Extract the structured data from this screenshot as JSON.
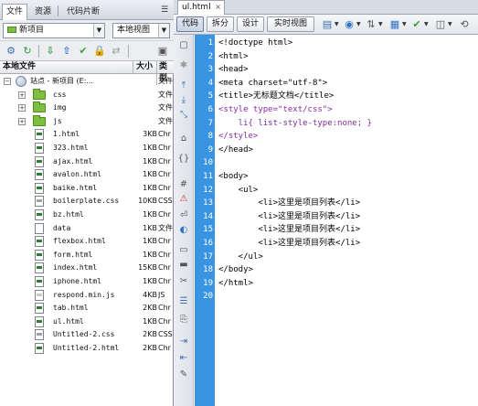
{
  "panel": {
    "tabs": [
      {
        "label": "文件",
        "active": true
      },
      {
        "label": "资源",
        "active": false
      },
      {
        "label": "代码片断",
        "active": false
      }
    ],
    "menu_icon": "panel-menu-icon",
    "site_select": "新项目",
    "view_select": "本地视图",
    "toolbar_icons": [
      "connect-icon",
      "refresh-icon",
      "get-file-icon",
      "put-file-icon",
      "checkout-icon",
      "checkin-icon",
      "sync-icon",
      "expand-icon"
    ],
    "columns": {
      "name": "本地文件",
      "size": "大小",
      "type": "类型"
    },
    "root": {
      "label": "站点 - 新项目 (E:...",
      "type": "文件"
    },
    "folders": [
      {
        "name": "css",
        "type": "文件"
      },
      {
        "name": "img",
        "type": "文件"
      },
      {
        "name": "js",
        "type": "文件"
      }
    ],
    "files": [
      {
        "name": "1.html",
        "size": "3KB",
        "type": "Chr",
        "kind": "html"
      },
      {
        "name": "323.html",
        "size": "1KB",
        "type": "Chr",
        "kind": "html"
      },
      {
        "name": "ajax.html",
        "size": "1KB",
        "type": "Chr",
        "kind": "html"
      },
      {
        "name": "avalon.html",
        "size": "1KB",
        "type": "Chr",
        "kind": "html"
      },
      {
        "name": "baike.html",
        "size": "1KB",
        "type": "Chr",
        "kind": "html"
      },
      {
        "name": "boilerplate.css",
        "size": "10KB",
        "type": "CSS",
        "kind": "css"
      },
      {
        "name": "bz.html",
        "size": "1KB",
        "type": "Chr",
        "kind": "html"
      },
      {
        "name": "data",
        "size": "1KB",
        "type": "文件",
        "kind": "doc"
      },
      {
        "name": "flexbox.html",
        "size": "1KB",
        "type": "Chr",
        "kind": "html"
      },
      {
        "name": "form.html",
        "size": "1KB",
        "type": "Chr",
        "kind": "html"
      },
      {
        "name": "index.html",
        "size": "15KB",
        "type": "Chr",
        "kind": "html"
      },
      {
        "name": "iphone.html",
        "size": "1KB",
        "type": "Chr",
        "kind": "html"
      },
      {
        "name": "respond.min.js",
        "size": "4KB",
        "type": "JS",
        "kind": "js"
      },
      {
        "name": "tab.html",
        "size": "2KB",
        "type": "Chr",
        "kind": "html"
      },
      {
        "name": "ul.html",
        "size": "1KB",
        "type": "Chr",
        "kind": "html"
      },
      {
        "name": "Untitled-2.css",
        "size": "2KB",
        "type": "CSS",
        "kind": "css"
      },
      {
        "name": "Untitled-2.html",
        "size": "2KB",
        "type": "Chr",
        "kind": "html"
      }
    ]
  },
  "editor": {
    "doc_tab": "ul.html",
    "close_glyph": "×",
    "view_buttons": [
      {
        "label": "代码",
        "active": true
      },
      {
        "label": "拆分",
        "active": false
      },
      {
        "label": "设计",
        "active": false
      },
      {
        "label": "实时视图",
        "active": false
      }
    ],
    "view_icons": [
      "multiscreen-icon",
      "browser-preview-icon",
      "file-management-icon",
      "page-title-icon",
      "check-page-icon",
      "visual-aids-icon",
      "refresh-icon"
    ],
    "gutter_icons": [
      "open-documents-icon",
      "show-code-navigator-icon",
      "collapse-full-tag-icon",
      "collapse-selection-icon",
      "expand-all-icon",
      "select-parent-tag-icon",
      "balance-braces-icon",
      "line-numbers-icon",
      "highlight-invalid-icon",
      "word-wrap-icon",
      "syntax-coloring-icon",
      "apply-comment-icon",
      "remove-comment-icon",
      "wrap-tag-icon",
      "recent-snippets-icon",
      "move-css-icon",
      "indent-icon",
      "outdent-icon",
      "format-source-icon"
    ],
    "lines": [
      {
        "n": "1",
        "text": "<!doctype html>",
        "style": "plain"
      },
      {
        "n": "2",
        "text": "<html>",
        "style": "plain"
      },
      {
        "n": "3",
        "text": "<head>",
        "style": "plain"
      },
      {
        "n": "4",
        "text": "<meta charset=\"utf-8\">",
        "style": "plain"
      },
      {
        "n": "5",
        "text": "<title>无标题文档</title>",
        "style": "plain"
      },
      {
        "n": "6",
        "text": "<style type=\"text/css\">",
        "style": "purple"
      },
      {
        "n": "7",
        "text": "    li{ list-style-type:none; }",
        "style": "css"
      },
      {
        "n": "8",
        "text": "</style>",
        "style": "purple"
      },
      {
        "n": "9",
        "text": "</head>",
        "style": "plain"
      },
      {
        "n": "10",
        "text": "",
        "style": "plain"
      },
      {
        "n": "11",
        "text": "<body>",
        "style": "plain"
      },
      {
        "n": "12",
        "text": "    <ul>",
        "style": "plain"
      },
      {
        "n": "13",
        "text": "        <li>这里是项目列表</li>",
        "style": "plain"
      },
      {
        "n": "14",
        "text": "        <li>这里是项目列表</li>",
        "style": "plain"
      },
      {
        "n": "15",
        "text": "        <li>这里是项目列表</li>",
        "style": "plain"
      },
      {
        "n": "16",
        "text": "        <li>这里是项目列表</li>",
        "style": "plain"
      },
      {
        "n": "17",
        "text": "    </ul>",
        "style": "plain"
      },
      {
        "n": "18",
        "text": "</body>",
        "style": "plain"
      },
      {
        "n": "19",
        "text": "</html>",
        "style": "plain"
      },
      {
        "n": "20",
        "text": "",
        "style": "plain"
      }
    ]
  }
}
